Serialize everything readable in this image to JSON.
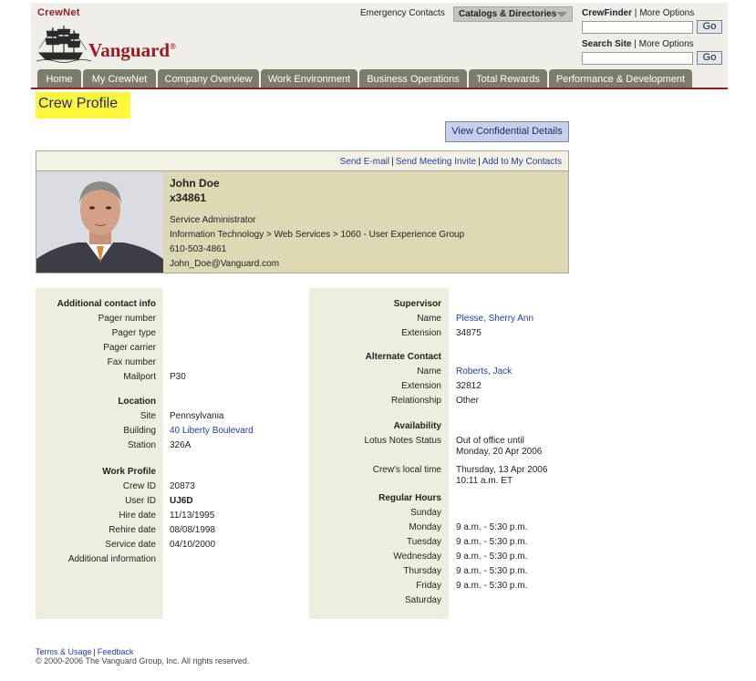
{
  "header": {
    "crewnet": "CrewNet",
    "brand": "Vanguard",
    "brand_mark": "®",
    "emergency_contacts": "Emergency Contacts",
    "catalogs": "Catalogs & Directories",
    "crewfinder_label": "CrewFinder",
    "crewfinder_more": "More Options",
    "search_label": "Search Site",
    "search_more": "More Options",
    "go_label": "Go",
    "separator": "|"
  },
  "nav": {
    "tabs": [
      {
        "label": "Home"
      },
      {
        "label": "My CrewNet"
      },
      {
        "label": "Company Overview"
      },
      {
        "label": "Work Environment"
      },
      {
        "label": "Business Operations"
      },
      {
        "label": "Total Rewards"
      },
      {
        "label": "Performance & Development"
      }
    ]
  },
  "page_title": "Crew Profile",
  "confidential_button": "View Confidential Details",
  "card": {
    "send_email": "Send E-mail",
    "send_invite": "Send Meeting Invite",
    "add_contacts": "Add to My Contacts",
    "name": "John Doe",
    "extension": "x34861",
    "title": "Service Administrator",
    "department": "Information Technology > Web Services > 1060 - User Experience Group",
    "phone": "610-503-4861",
    "email": "John_Doe@Vanguard.com"
  },
  "left": {
    "additional_head": "Additional contact info",
    "pager_number": "Pager number",
    "pager_type": "Pager type",
    "pager_carrier": "Pager carrier",
    "fax_number": "Fax number",
    "mailport_label": "Mailport",
    "mailport_value": "P30",
    "location_head": "Location",
    "site_label": "Site",
    "site_value": "Pennsylvania",
    "building_label": "Building",
    "building_value": "40 Liberty Boulevard",
    "station_label": "Station",
    "station_value": "326A",
    "work_head": "Work Profile",
    "crew_id_label": "Crew ID",
    "crew_id_value": "20873",
    "user_id_label": "User ID",
    "user_id_value": "UJ6D",
    "hire_label": "Hire date",
    "hire_value": "11/13/1995",
    "rehire_label": "Rehire date",
    "rehire_value": "08/08/1998",
    "service_label": "Service date",
    "service_value": "04/10/2000",
    "additional_info": "Additional information"
  },
  "right": {
    "supervisor_head": "Supervisor",
    "sup_name_label": "Name",
    "sup_name_value": "Plesse, Sherry Ann",
    "sup_ext_label": "Extension",
    "sup_ext_value": "34875",
    "alternate_head": "Alternate Contact",
    "alt_name_label": "Name",
    "alt_name_value": "Roberts, Jack",
    "alt_ext_label": "Extension",
    "alt_ext_value": "32812",
    "alt_rel_label": "Relationship",
    "alt_rel_value": "Other",
    "availability_head": "Availability",
    "lotus_label": "Lotus Notes Status",
    "lotus_value_1": "Out of office until",
    "lotus_value_2": "Monday, 20 Apr 2006",
    "local_time_label": "Crew's local time",
    "local_time_1": "Thursday, 13 Apr 2006",
    "local_time_2": "10:11 a.m. ET",
    "hours_head": "Regular Hours",
    "days": [
      {
        "day": "Sunday",
        "hours": ""
      },
      {
        "day": "Monday",
        "hours": "9 a.m. - 5:30 p.m."
      },
      {
        "day": "Tuesday",
        "hours": "9 a.m. - 5:30 p.m."
      },
      {
        "day": "Wednesday",
        "hours": "9 a.m. - 5:30 p.m."
      },
      {
        "day": "Thursday",
        "hours": "9 a.m. - 5:30 p.m."
      },
      {
        "day": "Friday",
        "hours": "9 a.m. - 5:30 p.m."
      },
      {
        "day": "Saturday",
        "hours": ""
      }
    ]
  },
  "footer": {
    "terms": "Terms & Usage",
    "feedback": "Feedback",
    "copyright": "© 2000-2006 The Vanguard Group, Inc. All rights reserved."
  }
}
